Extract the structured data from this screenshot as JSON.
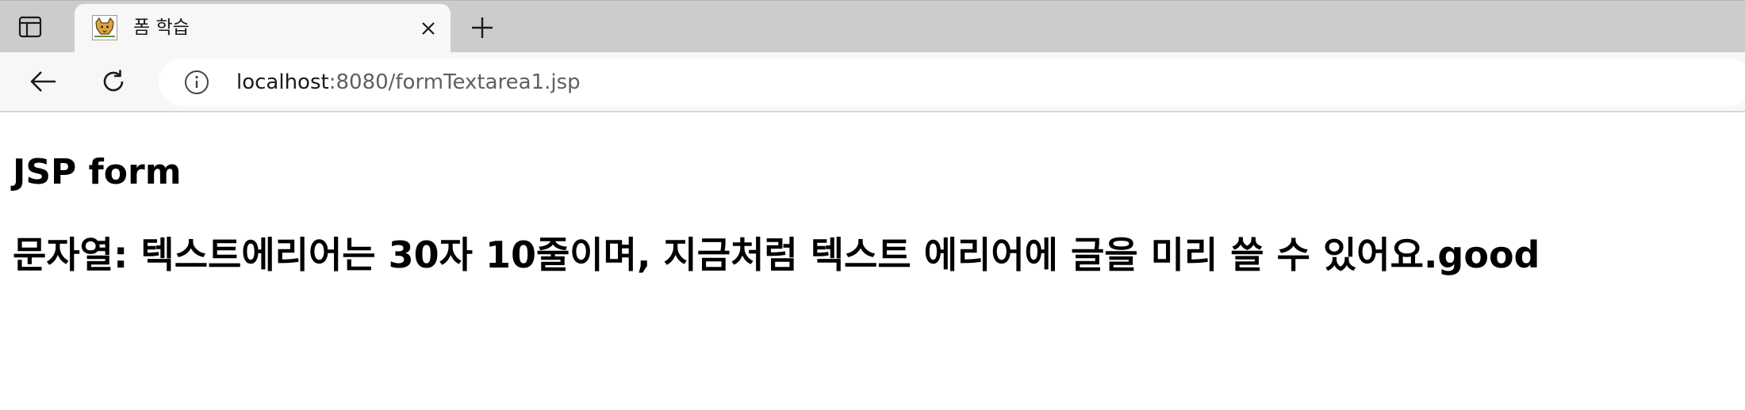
{
  "browser": {
    "tab": {
      "title": "폼 학습",
      "favicon": "tomcat-icon"
    },
    "toolbar": {
      "back_icon": "back-arrow-icon",
      "reload_icon": "reload-icon",
      "site_info_icon": "info-icon"
    },
    "address": {
      "host": "localhost",
      "rest": ":8080/formTextarea1.jsp"
    }
  },
  "page": {
    "title": "JSP form",
    "result_text": "문자열: 텍스트에리어는 30자 10줄이며, 지금처럼 텍스트 에리어에 글을 미리 쓸 수 있어요.good"
  },
  "colors": {
    "tabstrip_bg": "#cccccc",
    "active_tab_bg": "#f7f7f7",
    "page_bg": "#ffffff",
    "url_host": "#1a1a1a",
    "url_path": "#5f5f5f"
  }
}
